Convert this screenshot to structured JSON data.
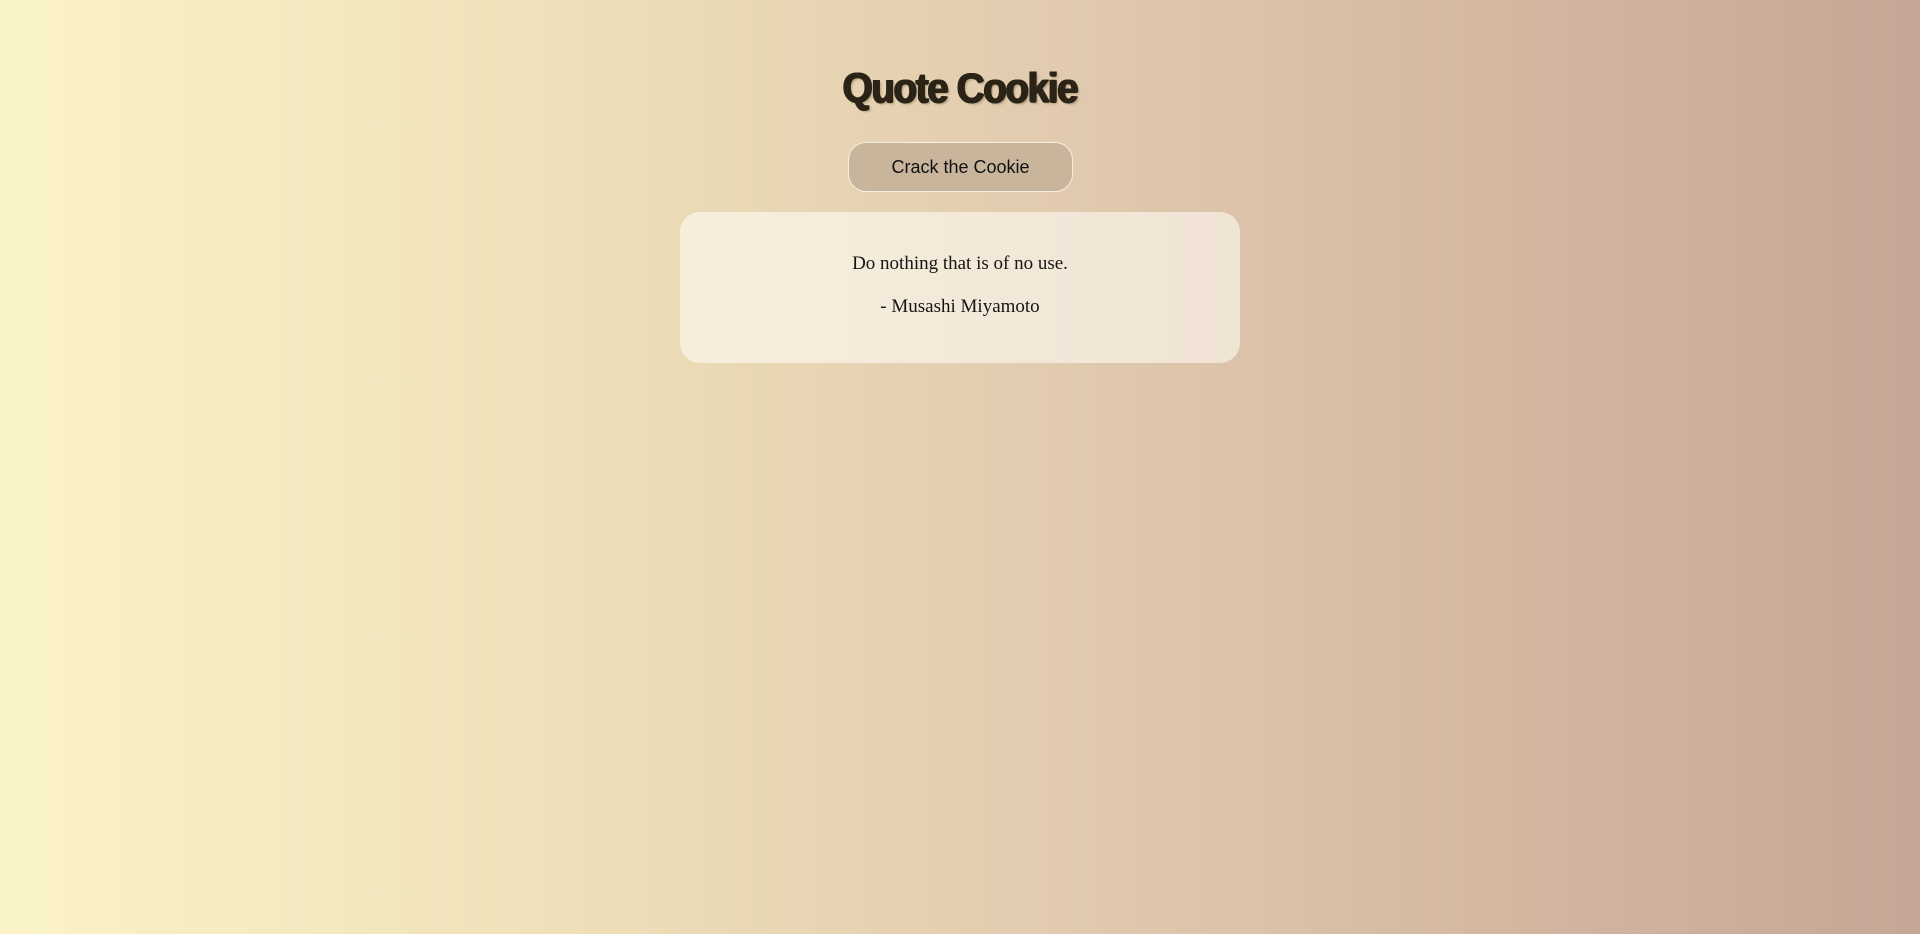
{
  "app": {
    "title": "Quote Cookie"
  },
  "controls": {
    "crack_button_label": "Crack the Cookie"
  },
  "quote": {
    "text": "Do nothing that is of no use.",
    "author": "- Musashi Miyamoto"
  },
  "colors": {
    "background_start": "#fbf3c8",
    "background_end": "#c6a696",
    "button_bg": "#c8b59c",
    "title_text": "#2b2416"
  }
}
